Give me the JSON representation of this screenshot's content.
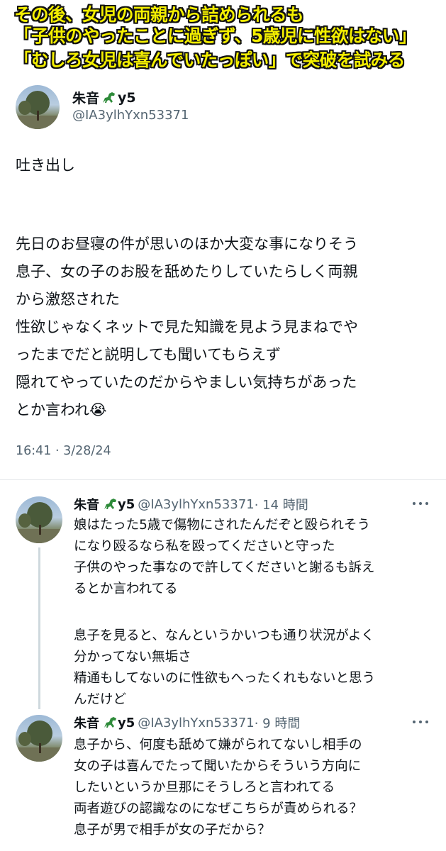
{
  "caption": {
    "line1": "その後、女児の両親から詰められるも",
    "line2": "「子供のやったことに過ぎず、5歳児に性欲はない」",
    "line3": "「むしろ女児は喜んでいたっぽい」で突破を試みる"
  },
  "tweet": {
    "name": "朱音",
    "name_suffix": "y5",
    "handle": "@IA3ylhYxn53371",
    "lines": [
      "吐き出し",
      "",
      "先日のお昼寝の件が思いのほか大変な事になりそう",
      "息子、女の子のお股を舐めたりしていたらしく両親",
      "から激怒された",
      "性欲じゃなくネットで見た知識を見よう見まねでや",
      "ったまでだと説明しても聞いてもらえず",
      "隠れてやっていたのだからやましい気持ちがあった",
      "とか言われ😭"
    ],
    "timestamp": "16:41 · 3/28/24"
  },
  "replies": [
    {
      "name": "朱音",
      "name_suffix": "y5",
      "handle": "@IA3ylhYxn53371",
      "time": "· 14 時間",
      "lines": [
        "娘はたった5歳で傷物にされたんだぞと殴られそう",
        "になり殴るなら私を殴ってくださいと守った",
        "子供のやった事なので許してくださいと謝るも訴え",
        "るとか言われてる",
        "",
        "息子を見ると、なんというかいつも通り状況がよく",
        "分かってない無垢さ",
        "精通もしてないのに性欲もへったくれもないと思う",
        "んだけど"
      ]
    },
    {
      "name": "朱音",
      "name_suffix": "y5",
      "handle": "@IA3ylhYxn53371",
      "time": "· 9 時間",
      "lines": [
        "息子から、何度も舐めて嫌がられてないし相手の",
        "女の子は喜んでたって聞いたからそういう方向に",
        "したいというか旦那にそうしろと言われてる",
        "両者遊びの認識なのになぜこちらが責められる？",
        "息子が男で相手が女の子だから？"
      ]
    }
  ],
  "icons": {
    "name_emoji": "dinosaur-icon",
    "more": "more-options-icon"
  },
  "colors": {
    "caption_text": "#f4ef00",
    "caption_outline": "#111111",
    "secondary_text": "#536471",
    "thread_line": "#cfd9de"
  }
}
